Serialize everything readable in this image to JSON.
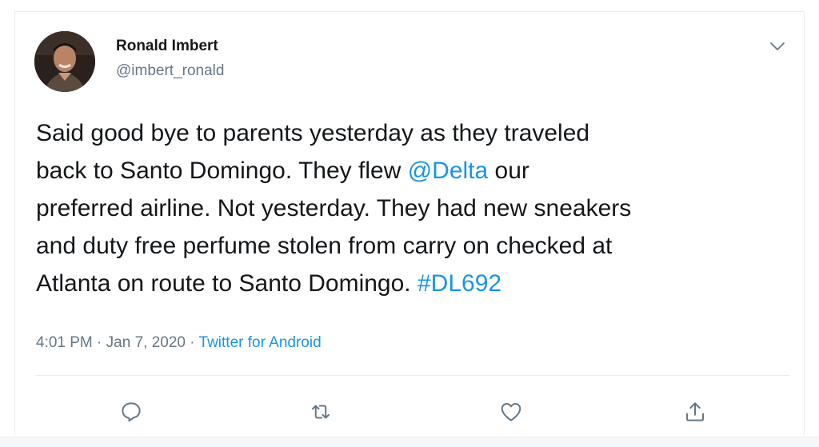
{
  "user": {
    "name": "Ronald Imbert",
    "handle": "@imbert_ronald"
  },
  "tweet": {
    "lines": [
      {
        "pre": "Said good bye to parents yesterday as they traveled",
        "link": "",
        "post": ""
      },
      {
        "pre": "back to Santo Domingo. They flew ",
        "link": "@Delta",
        "post": " our"
      },
      {
        "pre": "preferred airline. Not yesterday. They had new sneakers",
        "link": "",
        "post": ""
      },
      {
        "pre": "and duty free perfume stolen from carry on checked at",
        "link": "",
        "post": ""
      },
      {
        "pre": "Atlanta on route to Santo Domingo. ",
        "link": "#DL692",
        "post": ""
      }
    ]
  },
  "meta": {
    "time": "4:01 PM",
    "sep1": " · ",
    "date": "Jan 7, 2020",
    "sep2": " · ",
    "source": "Twitter for Android"
  },
  "icons": {
    "more": "chevron-down-icon",
    "reply": "reply-icon",
    "retweet": "retweet-icon",
    "like": "heart-icon",
    "share": "share-icon"
  },
  "colors": {
    "link": "#1b95e0",
    "secondary": "#657786",
    "text": "#14171a",
    "border": "#e6ecf0"
  }
}
